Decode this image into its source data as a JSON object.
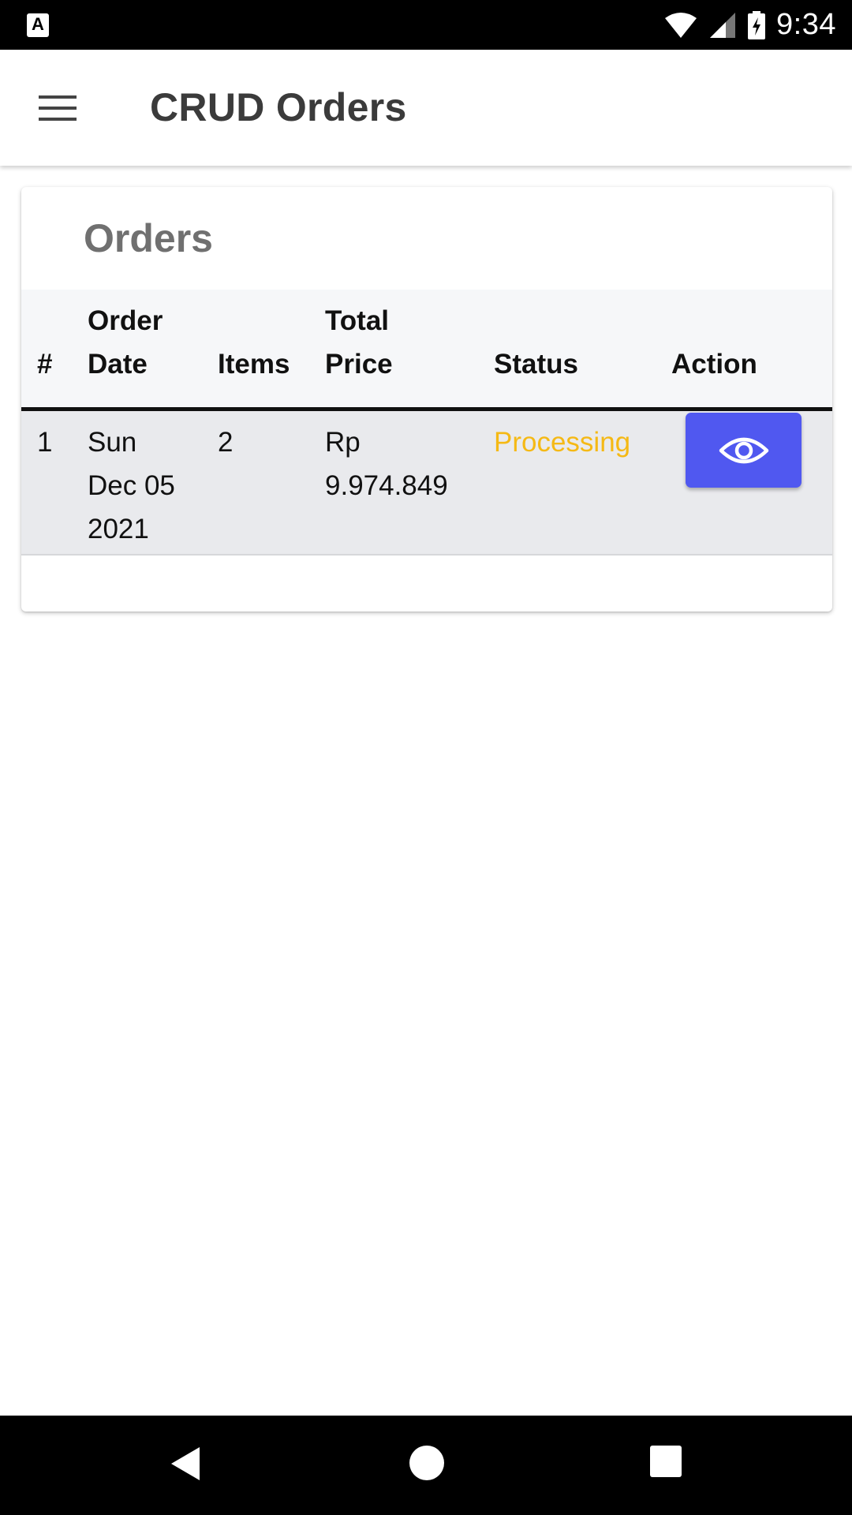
{
  "status_bar": {
    "app_icon_letter": "A",
    "time": "9:34"
  },
  "app_bar": {
    "title": "CRUD Orders",
    "menu_icon": "hamburger-menu-icon"
  },
  "card": {
    "title": "Orders",
    "table": {
      "headers": {
        "index": "#",
        "order_date_line1": "Order",
        "order_date_line2": "Date",
        "items": "Items",
        "total_price_line1": "Total",
        "total_price_line2": "Price",
        "status": "Status",
        "action": "Action"
      },
      "rows": [
        {
          "index": "1",
          "date_line1": "Sun",
          "date_line2": "Dec 05",
          "date_line3": "2021",
          "items": "2",
          "price_line1": "Rp",
          "price_line2": "9.974.849",
          "status": "Processing",
          "action_icon": "eye-icon"
        }
      ]
    }
  },
  "colors": {
    "status_processing": "#f5b915",
    "action_button": "#5058f0"
  }
}
